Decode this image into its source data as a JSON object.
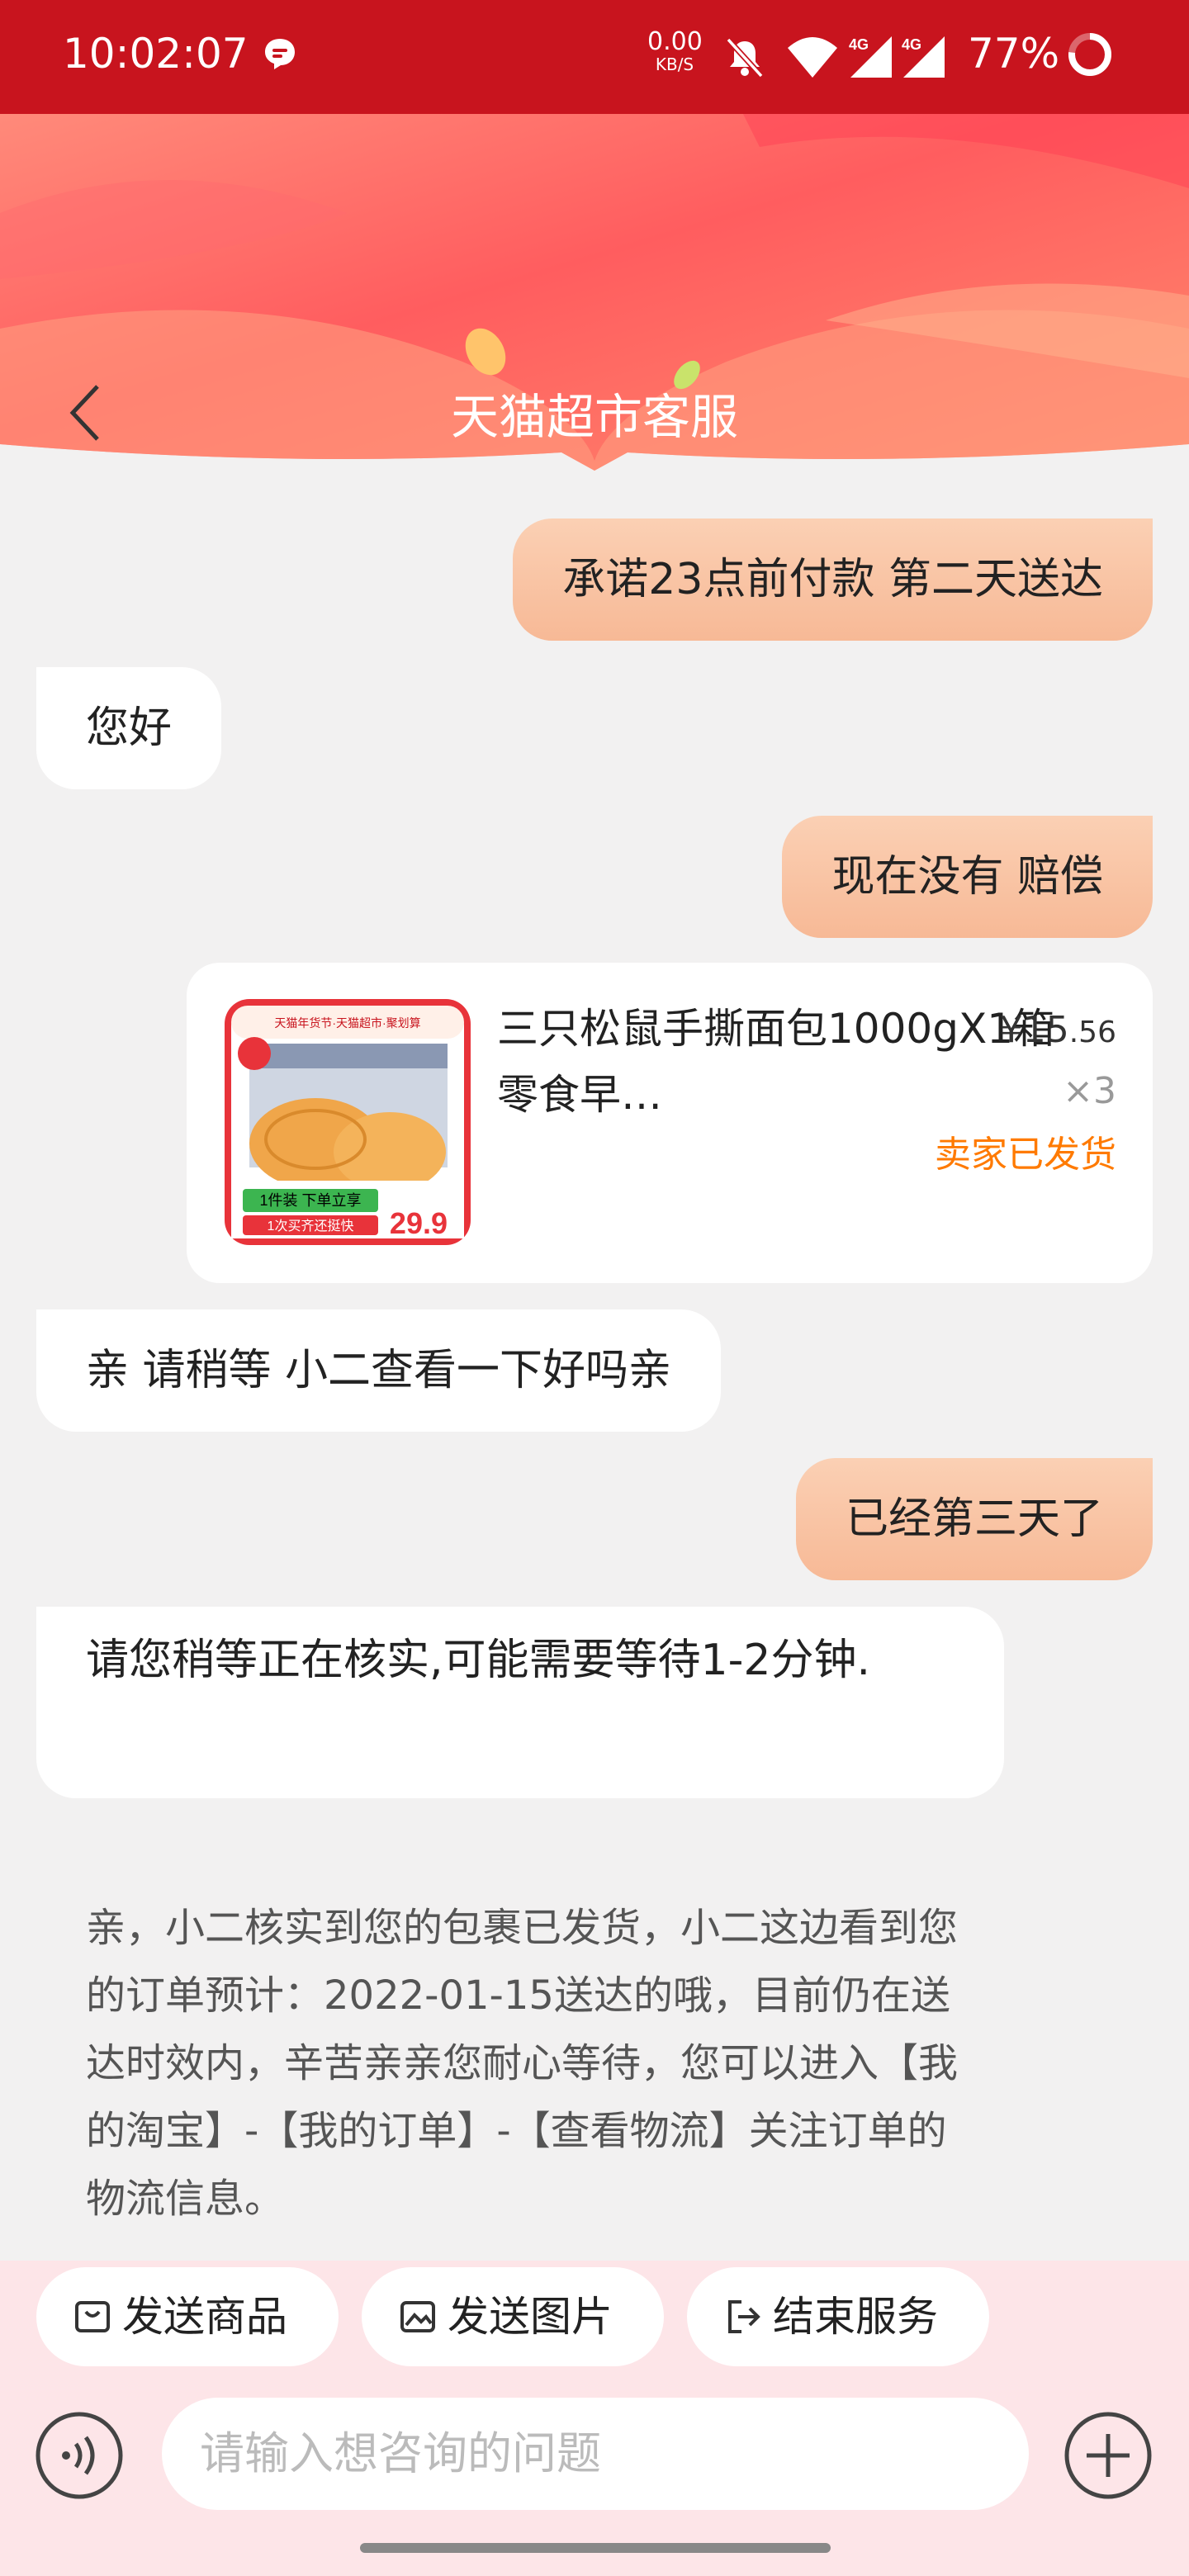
{
  "status_bar": {
    "time": "10:02:07",
    "speed_value": "0.00",
    "speed_unit": "KB/S",
    "network_1": "4G",
    "network_2": "4G",
    "battery": "77%"
  },
  "header": {
    "title": "天猫超市客服"
  },
  "messages": {
    "m1": "承诺23点前付款 第二天送达",
    "m2": "您好",
    "m3": "现在没有 赔偿",
    "m4": "亲 请稍等 小二查看一下好吗亲",
    "m5": "已经第三天了",
    "m6": "请您稍等正在核实,可能需要等待1-2分钟.",
    "m7": "亲，小二核实到您的包裹已发货，小二这边看到您的订单预计：2022-01-15送达的哦，目前仍在送达时效内，辛苦亲亲您耐心等待，您可以进入【我的淘宝】-【我的订单】-【查看物流】关注订单的物流信息。"
  },
  "product": {
    "name": "三只松鼠手撕面包1000gX1箱零食早…",
    "price_main": "¥15",
    "price_decimal": ".56",
    "quantity": "×3",
    "status": "卖家已发货",
    "thumb_banner": "天猫年货节·天猫超市·聚划算",
    "thumb_tag_1": "1件装 下单立享",
    "thumb_tag_2": "1次买齐还挺快",
    "thumb_price": "29.9"
  },
  "actions": {
    "send_product": "发送商品",
    "send_image": "发送图片",
    "end_service": "结束服务"
  },
  "input": {
    "placeholder": "请输入想咨询的问题"
  },
  "colors": {
    "status_bar": "#c8141e",
    "outgoing_bubble": "#f9c4a6",
    "accent_orange": "#ff7a00",
    "bottom_panel": "#fde5e8"
  }
}
